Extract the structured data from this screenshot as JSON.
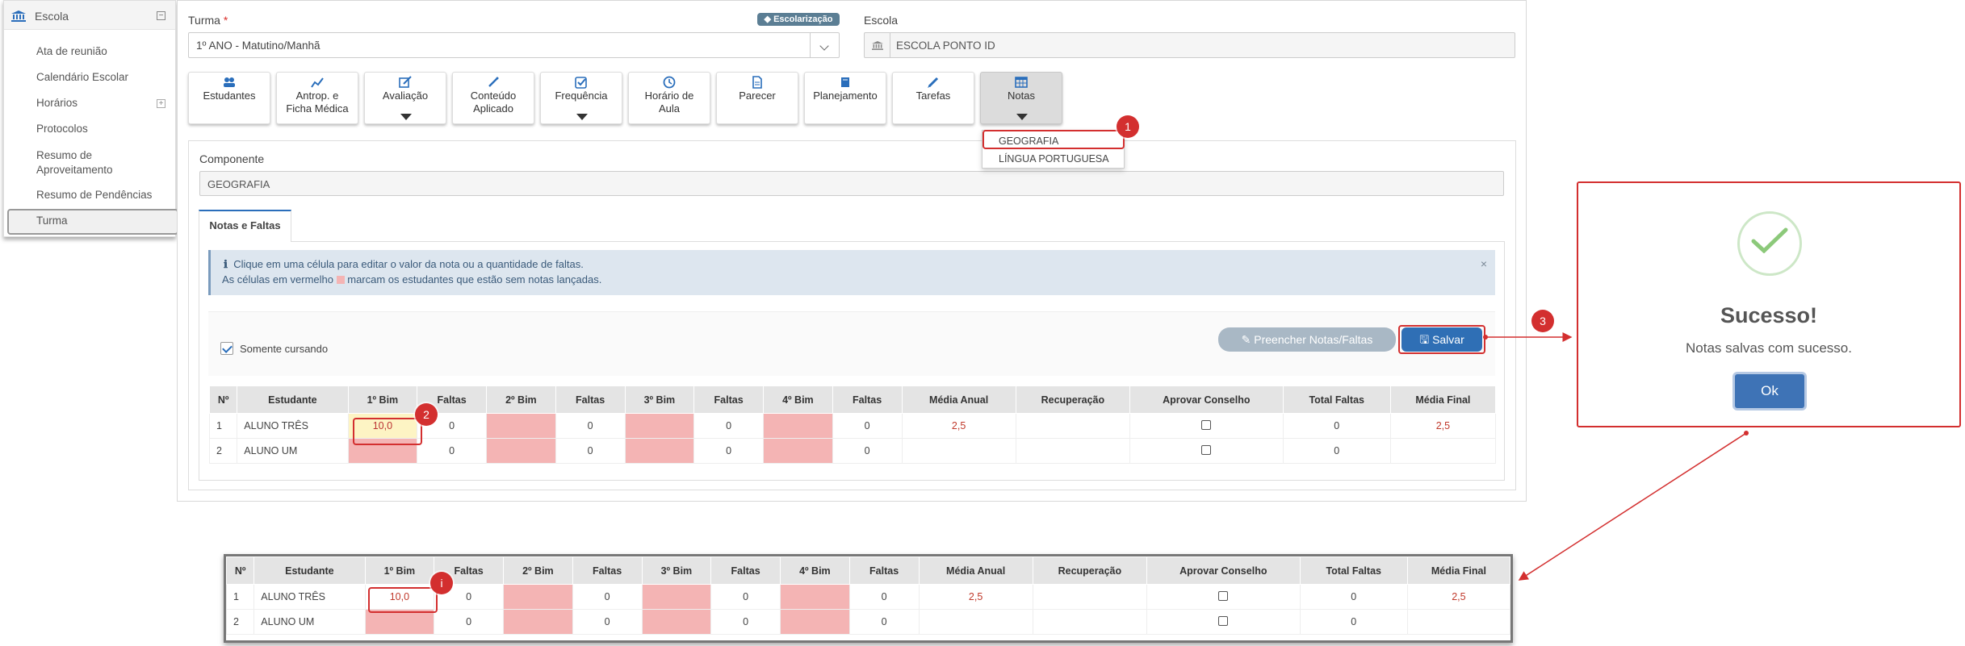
{
  "sidebar": {
    "header": "Escola",
    "items": [
      {
        "label": "Ata de reunião"
      },
      {
        "label": "Calendário Escolar"
      },
      {
        "label": "Horários"
      },
      {
        "label": "Protocolos"
      },
      {
        "label": "Resumo de Aproveitamento"
      },
      {
        "label": "Resumo de Pendências"
      },
      {
        "label": "Turma"
      }
    ]
  },
  "form": {
    "turma_label": "Turma",
    "required_mark": "*",
    "turma_value": "1º ANO - Matutino/Manhã",
    "badge": "Escolarização",
    "escola_label": "Escola",
    "escola_value": "ESCOLA PONTO ID",
    "componente_label": "Componente",
    "componente_value": "GEOGRAFIA"
  },
  "tabs": [
    {
      "line1": "Estudantes",
      "line2": "",
      "icon": "users-icon"
    },
    {
      "line1": "Antrop. e",
      "line2": "Ficha Médica",
      "icon": "chart-icon"
    },
    {
      "line1": "Avaliação",
      "line2": "",
      "icon": "edit-icon"
    },
    {
      "line1": "Conteúdo",
      "line2": "Aplicado",
      "icon": "pen-icon"
    },
    {
      "line1": "Frequência",
      "line2": "",
      "icon": "checkbox-icon"
    },
    {
      "line1": "Horário de",
      "line2": "Aula",
      "icon": "clock-icon"
    },
    {
      "line1": "Parecer",
      "line2": "",
      "icon": "document-icon"
    },
    {
      "line1": "Planejamento",
      "line2": "",
      "icon": "book-icon"
    },
    {
      "line1": "Tarefas",
      "line2": "",
      "icon": "pencil-icon"
    },
    {
      "line1": "Notas",
      "line2": "",
      "icon": "table-icon"
    }
  ],
  "dropdown": {
    "options": [
      "GEOGRAFIA",
      "LÍNGUA PORTUGUESA"
    ]
  },
  "inner_tab": "Notas e Faltas",
  "info": {
    "line1": "Clique em uma célula para editar o valor da nota ou a quantidade de faltas.",
    "line2a": "As células em vermelho",
    "line2b": "marcam os estudantes que estão sem notas lançadas."
  },
  "toolbar": {
    "somente_cursando": "Somente cursando",
    "fill_label": "Preencher Notas/Faltas",
    "save_label": "Salvar"
  },
  "table": {
    "headers": [
      "Nº",
      "Estudante",
      "1º Bim",
      "Faltas",
      "2º Bim",
      "Faltas",
      "3º Bim",
      "Faltas",
      "4º Bim",
      "Faltas",
      "Média Anual",
      "Recuperação",
      "Aprovar Conselho",
      "Total Faltas",
      "Média Final"
    ],
    "rows": [
      {
        "num": "1",
        "name": "ALUNO TRÊS",
        "b1": "10,0",
        "f1": "0",
        "b2": "",
        "f2": "0",
        "b3": "",
        "f3": "0",
        "b4": "",
        "f4": "0",
        "media_anual": "2,5",
        "recuperacao": "",
        "aprovar": false,
        "total_faltas": "0",
        "media_final": "2,5"
      },
      {
        "num": "2",
        "name": "ALUNO UM",
        "b1": "",
        "f1": "0",
        "b2": "",
        "f2": "0",
        "b3": "",
        "f3": "0",
        "b4": "",
        "f4": "0",
        "media_anual": "",
        "recuperacao": "",
        "aprovar": false,
        "total_faltas": "0",
        "media_final": ""
      }
    ]
  },
  "modal": {
    "title": "Sucesso!",
    "message": "Notas salvas com sucesso.",
    "ok_label": "Ok"
  },
  "markers": [
    "1",
    "2",
    "3",
    "i"
  ],
  "colors": {
    "accent": "#2f6fb5",
    "highlight": "#d32f2f",
    "missing_grade": "#f4b4b4",
    "edited_cell": "#fdf4c4",
    "success": "#8cc97a"
  }
}
